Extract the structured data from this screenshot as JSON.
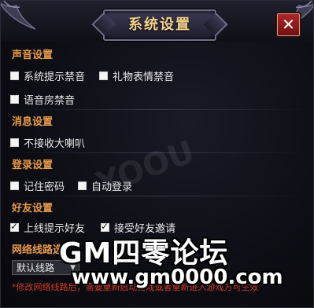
{
  "window": {
    "title": "系统设置",
    "close_glyph": "✕"
  },
  "sections": {
    "sound": {
      "heading": "声音设置",
      "options": [
        {
          "label": "系统提示禁音",
          "checked": false
        },
        {
          "label": "礼物表情禁音",
          "checked": false
        },
        {
          "label": "语音房禁音",
          "checked": false
        }
      ]
    },
    "message": {
      "heading": "消息设置",
      "options": [
        {
          "label": "不接收大喇叭",
          "checked": false
        }
      ]
    },
    "login": {
      "heading": "登录设置",
      "options": [
        {
          "label": "记住密码",
          "checked": false
        },
        {
          "label": "自动登录",
          "checked": false
        }
      ]
    },
    "friends": {
      "heading": "好友设置",
      "options": [
        {
          "label": "上线提示好友",
          "checked": true
        },
        {
          "label": "接受好友邀请",
          "checked": true
        }
      ]
    },
    "network": {
      "heading": "网络线路选",
      "selected": "默认线路",
      "footnote": "*修改网络线路后，需要重新启动游戏或者重新进入游戏方可生效"
    }
  },
  "watermark": {
    "title": "GM四零论坛",
    "url": "www.gm0000.com",
    "faint": "YOOU"
  },
  "colors": {
    "accent": "#e79a47",
    "title": "#f4d28a",
    "close": "#b0262a",
    "note": "#d23b2a"
  }
}
